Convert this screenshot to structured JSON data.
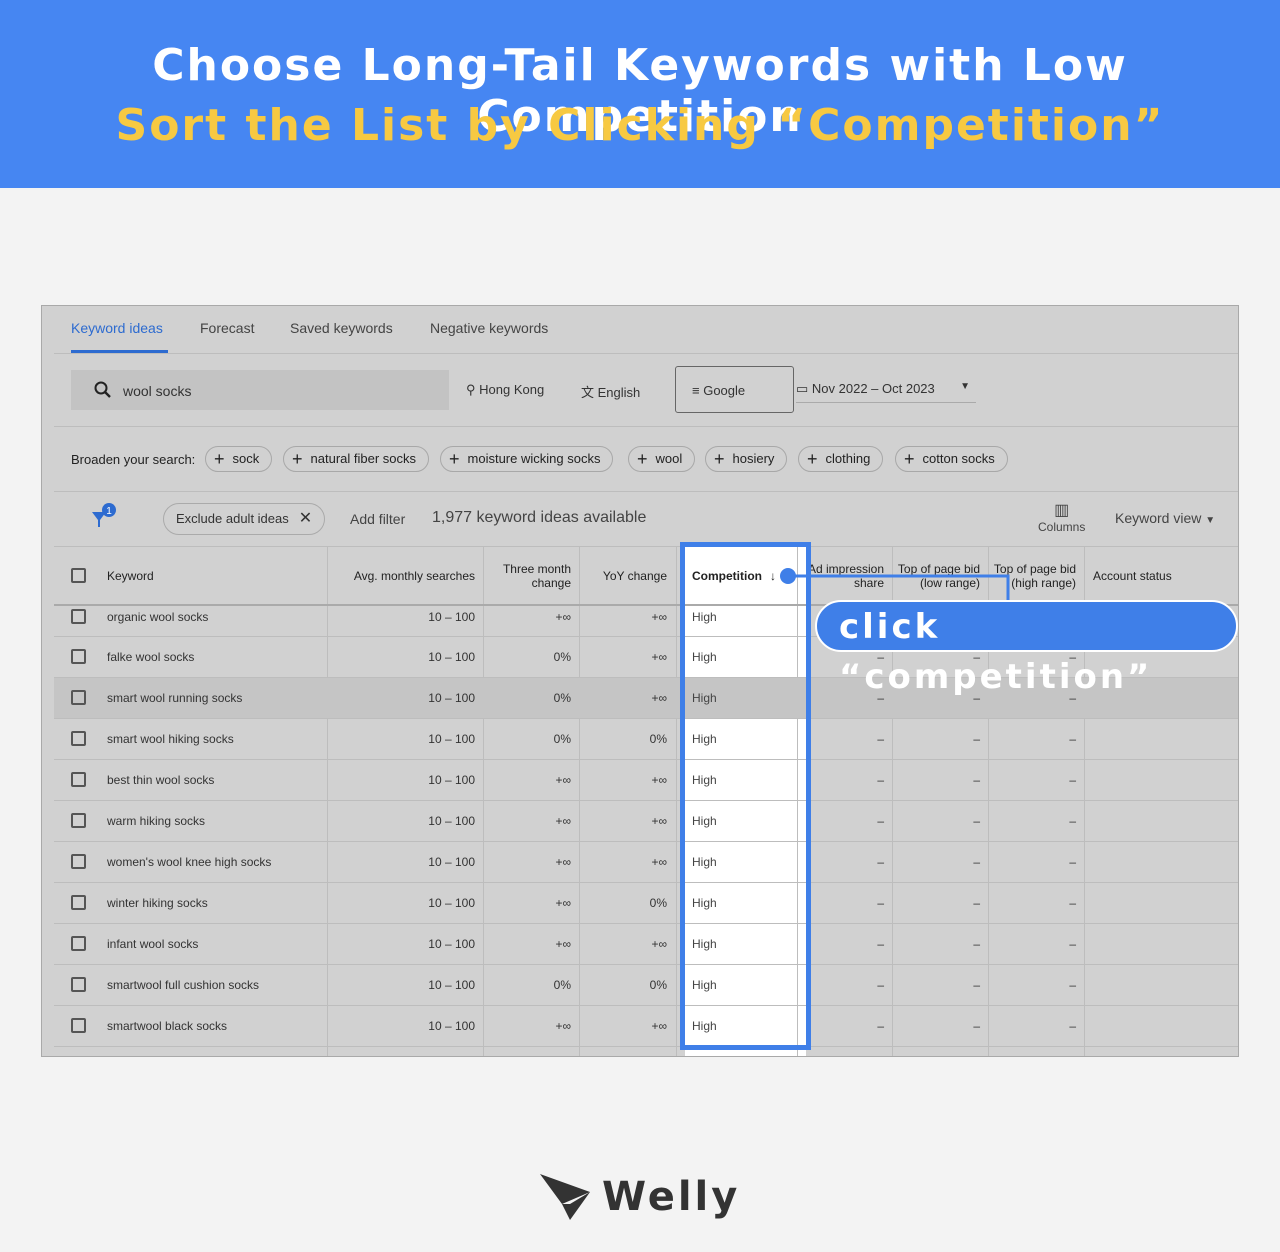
{
  "banner": {
    "title": "Choose Long-Tail Keywords with Low Competition",
    "subtitle": "Sort the List by Clicking “Competition”"
  },
  "tabs": [
    {
      "label": "Keyword ideas",
      "active": true
    },
    {
      "label": "Forecast"
    },
    {
      "label": "Saved keywords"
    },
    {
      "label": "Negative keywords"
    }
  ],
  "search": {
    "value": "wool socks",
    "location": "Hong Kong",
    "language": "English",
    "network": "Google",
    "date_range": "Nov 2022 – Oct 2023"
  },
  "broaden": {
    "label": "Broaden your search:",
    "chips": [
      "sock",
      "natural fiber socks",
      "moisture wicking socks",
      "wool",
      "hosiery",
      "clothing",
      "cotton socks"
    ]
  },
  "filters": {
    "badge": "1",
    "exclude": "Exclude adult ideas",
    "add_filter": "Add filter",
    "count": "1,977 keyword ideas available",
    "columns": "Columns",
    "view": "Keyword view"
  },
  "table": {
    "headers": [
      "Keyword",
      "Avg. monthly searches",
      "Three month change",
      "YoY change",
      "Competition",
      "Ad impression share",
      "Top of page bid (low range)",
      "Top of page bid (high range)",
      "Account status"
    ],
    "rows": [
      [
        "organic wool socks",
        "10 – 100",
        "+∞",
        "+∞",
        "High"
      ],
      [
        "falke wool socks",
        "10 – 100",
        "0%",
        "+∞",
        "High"
      ],
      [
        "smart wool running socks",
        "10 – 100",
        "0%",
        "+∞",
        "High"
      ],
      [
        "smart wool hiking socks",
        "10 – 100",
        "0%",
        "0%",
        "High"
      ],
      [
        "best thin wool socks",
        "10 – 100",
        "+∞",
        "+∞",
        "High"
      ],
      [
        "warm hiking socks",
        "10 – 100",
        "+∞",
        "+∞",
        "High"
      ],
      [
        "women's wool knee high socks",
        "10 – 100",
        "+∞",
        "+∞",
        "High"
      ],
      [
        "winter hiking socks",
        "10 – 100",
        "+∞",
        "0%",
        "High"
      ],
      [
        "infant wool socks",
        "10 – 100",
        "+∞",
        "+∞",
        "High"
      ],
      [
        "smartwool full cushion socks",
        "10 – 100",
        "0%",
        "0%",
        "High"
      ],
      [
        "smartwool black socks",
        "10 – 100",
        "+∞",
        "+∞",
        "High"
      ]
    ],
    "empty": "–"
  },
  "callout": "click “competition”",
  "logo": {
    "text": "Welly"
  },
  "colors": {
    "banner": "#4686f2",
    "accent": "#3f7fe8",
    "subtitle": "#f7c942"
  }
}
